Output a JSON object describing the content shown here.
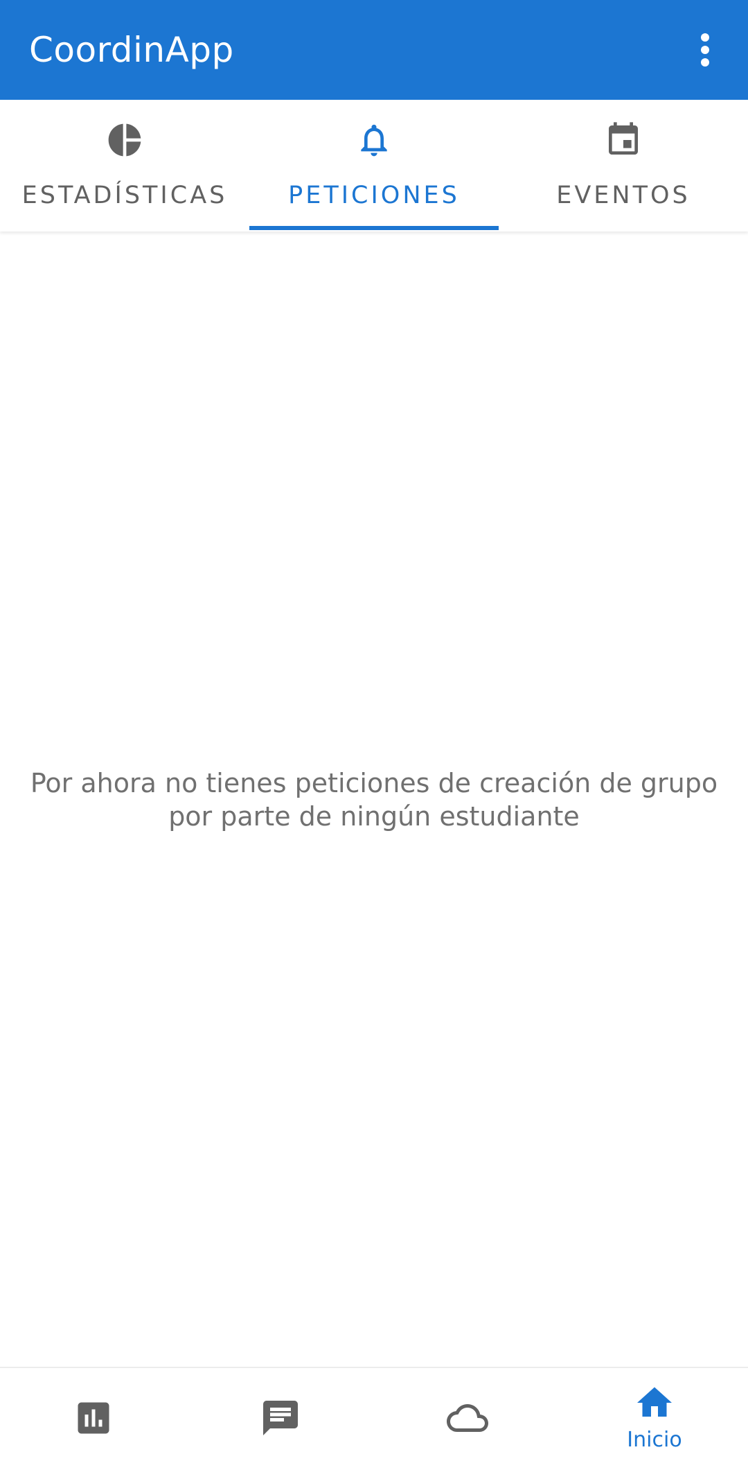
{
  "app_bar": {
    "title": "CoordinApp",
    "menu_icon": "more-vert-icon",
    "background_color": "#1c76d2"
  },
  "tabs": [
    {
      "label": "ESTADÍSTICAS",
      "icon": "pie-chart-icon",
      "active": false
    },
    {
      "label": "PETICIONES",
      "icon": "bell-icon",
      "active": true
    },
    {
      "label": "EVENTOS",
      "icon": "calendar-icon",
      "active": false
    }
  ],
  "content": {
    "empty_message": "Por ahora no tienes peticiones de creación de grupo por parte de ningún estudiante"
  },
  "bottom_nav": [
    {
      "label": "",
      "icon": "bar-chart-icon",
      "active": false
    },
    {
      "label": "",
      "icon": "chat-icon",
      "active": false
    },
    {
      "label": "",
      "icon": "cloud-icon",
      "active": false
    },
    {
      "label": "Inicio",
      "icon": "home-icon",
      "active": true
    }
  ],
  "colors": {
    "accent": "#1c76d2",
    "inactive": "#616161",
    "message_text": "#707070"
  }
}
